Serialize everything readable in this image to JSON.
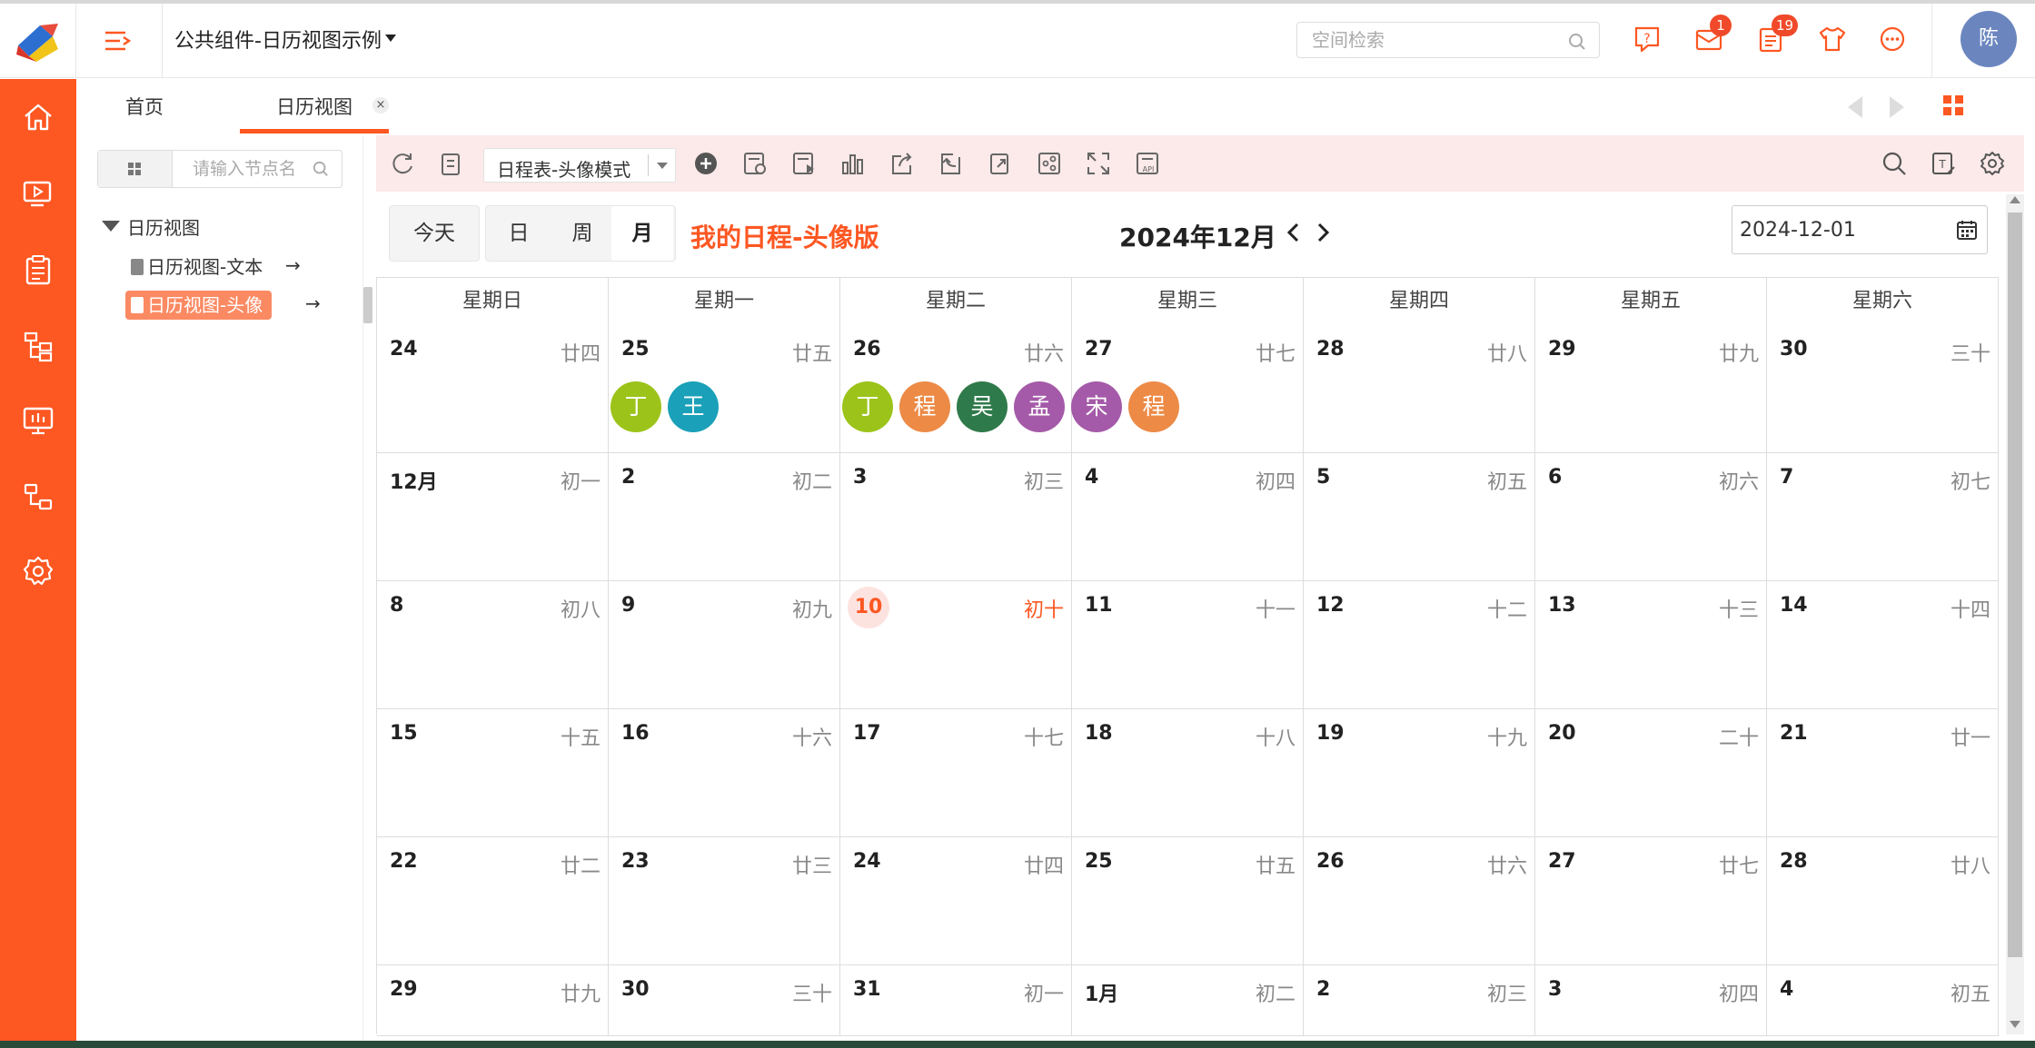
{
  "header": {
    "app_title": "公共组件-日历视图示例",
    "search_placeholder": "空间检索",
    "mail_badge": "1",
    "todo_badge": "19",
    "user_avatar": "陈"
  },
  "tabs": [
    {
      "label": "首页"
    },
    {
      "label": "日历视图",
      "active": true,
      "close": "×"
    }
  ],
  "tree": {
    "search_placeholder": "请输入节点名",
    "root": "日历视图",
    "leaves": [
      {
        "label": "日历视图-文本",
        "arrow": "→"
      },
      {
        "label": "日历视图-头像",
        "arrow": "→",
        "selected": true
      }
    ]
  },
  "toolbar": {
    "view_select": "日程表-头像模式"
  },
  "calendar": {
    "today_button": "今天",
    "view_day": "日",
    "view_week": "周",
    "view_month": "月",
    "title": "我的日程-头像版",
    "month_label": "2024年12月",
    "date_value": "2024-12-01",
    "weekdays": [
      "星期日",
      "星期一",
      "星期二",
      "星期三",
      "星期四",
      "星期五",
      "星期六"
    ],
    "weeks": [
      [
        {
          "day": "24",
          "lunar": "廿四"
        },
        {
          "day": "25",
          "lunar": "廿五",
          "avatars": [
            {
              "name": "丁",
              "color": "#9cc31a"
            },
            {
              "name": "王",
              "color": "#1aa0b8"
            }
          ]
        },
        {
          "day": "26",
          "lunar": "廿六",
          "avatars": [
            {
              "name": "丁",
              "color": "#9cc31a"
            },
            {
              "name": "程",
              "color": "#ec8a46"
            },
            {
              "name": "吴",
              "color": "#2f7a4a"
            },
            {
              "name": "孟",
              "color": "#a45aa8"
            },
            {
              "name": "宋",
              "color": "#a45aa8"
            },
            {
              "name": "程",
              "color": "#ec8a46"
            }
          ]
        },
        {
          "day": "27",
          "lunar": "廿七"
        },
        {
          "day": "28",
          "lunar": "廿八"
        },
        {
          "day": "29",
          "lunar": "廿九"
        },
        {
          "day": "30",
          "lunar": "三十"
        }
      ],
      [
        {
          "day": "12月",
          "lunar": "初一"
        },
        {
          "day": "2",
          "lunar": "初二"
        },
        {
          "day": "3",
          "lunar": "初三"
        },
        {
          "day": "4",
          "lunar": "初四"
        },
        {
          "day": "5",
          "lunar": "初五"
        },
        {
          "day": "6",
          "lunar": "初六"
        },
        {
          "day": "7",
          "lunar": "初七"
        }
      ],
      [
        {
          "day": "8",
          "lunar": "初八"
        },
        {
          "day": "9",
          "lunar": "初九"
        },
        {
          "day": "10",
          "lunar": "初十",
          "today": true
        },
        {
          "day": "11",
          "lunar": "十一"
        },
        {
          "day": "12",
          "lunar": "十二"
        },
        {
          "day": "13",
          "lunar": "十三"
        },
        {
          "day": "14",
          "lunar": "十四"
        }
      ],
      [
        {
          "day": "15",
          "lunar": "十五"
        },
        {
          "day": "16",
          "lunar": "十六"
        },
        {
          "day": "17",
          "lunar": "十七"
        },
        {
          "day": "18",
          "lunar": "十八"
        },
        {
          "day": "19",
          "lunar": "十九"
        },
        {
          "day": "20",
          "lunar": "二十"
        },
        {
          "day": "21",
          "lunar": "廿一"
        }
      ],
      [
        {
          "day": "22",
          "lunar": "廿二"
        },
        {
          "day": "23",
          "lunar": "廿三"
        },
        {
          "day": "24",
          "lunar": "廿四"
        },
        {
          "day": "25",
          "lunar": "廿五"
        },
        {
          "day": "26",
          "lunar": "廿六"
        },
        {
          "day": "27",
          "lunar": "廿七"
        },
        {
          "day": "28",
          "lunar": "廿八"
        }
      ],
      [
        {
          "day": "29",
          "lunar": "廿九"
        },
        {
          "day": "30",
          "lunar": "三十"
        },
        {
          "day": "31",
          "lunar": "初一"
        },
        {
          "day": "1月",
          "lunar": "初二"
        },
        {
          "day": "2",
          "lunar": "初三"
        },
        {
          "day": "3",
          "lunar": "初四"
        },
        {
          "day": "4",
          "lunar": "初五"
        }
      ]
    ]
  },
  "colors": {
    "brand": "#fd5722",
    "toolbar_bg": "#fce9e9"
  }
}
